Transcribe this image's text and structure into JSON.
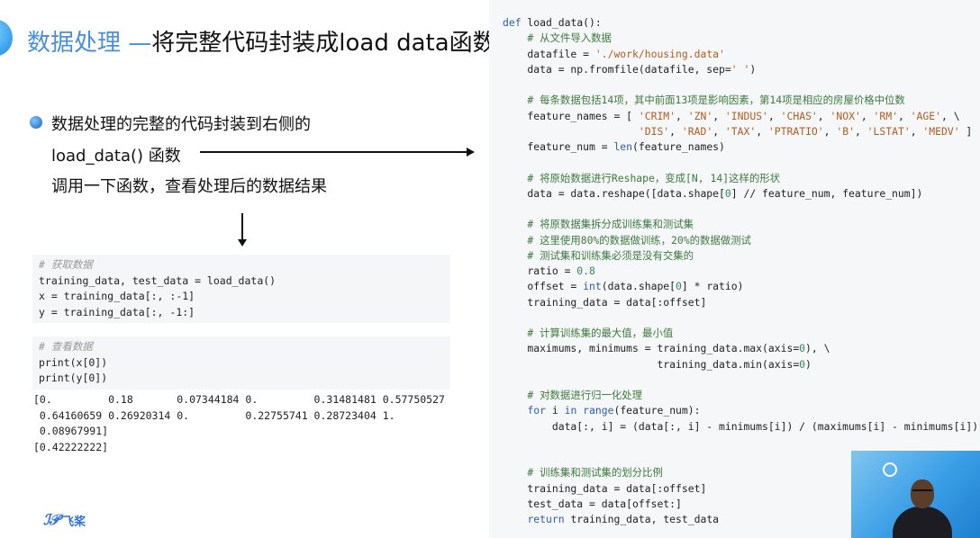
{
  "slide": {
    "title_part1": "数据处理 ",
    "title_dash": "—",
    "title_part2": "将完整代码封装成load data函数",
    "bullet_line1": "数据处理的完整的代码封装到右侧的",
    "bullet_line2": "load_data() 函数",
    "bullet_line3": "调用一下函数，查看处理后的数据结果",
    "logo_text": "飞桨",
    "logo_mark": "ℐ𝒫"
  },
  "notebook": {
    "cell1": {
      "comment": "# 获取数据",
      "lines": [
        "training_data, test_data = load_data()",
        "x = training_data[:, :-1]",
        "y = training_data[:, -1:]"
      ]
    },
    "cell2": {
      "comment": "# 查看数据",
      "lines": [
        "print(x[0])",
        "print(y[0])"
      ]
    },
    "output": [
      "[0.         0.18       0.07344184 0.         0.31481481 0.57750527",
      " 0.64160659 0.26920314 0.         0.22755741 0.28723404 1.",
      " 0.08967991]",
      "[0.42222222]"
    ]
  },
  "code": {
    "lines": [
      "def load_data():",
      "    # 从文件导入数据",
      "    datafile = './work/housing.data'",
      "    data = np.fromfile(datafile, sep=' ')",
      "",
      "    # 每条数据包括14项，其中前面13项是影响因素，第14项是相应的房屋价格中位数",
      "    feature_names = [ 'CRIM', 'ZN', 'INDUS', 'CHAS', 'NOX', 'RM', 'AGE', \\",
      "                      'DIS', 'RAD', 'TAX', 'PTRATIO', 'B', 'LSTAT', 'MEDV' ]",
      "    feature_num = len(feature_names)",
      "",
      "    # 将原始数据进行Reshape，变成[N, 14]这样的形状",
      "    data = data.reshape([data.shape[0] // feature_num, feature_num])",
      "",
      "    # 将原数据集拆分成训练集和测试集",
      "    # 这里使用80%的数据做训练，20%的数据做测试",
      "    # 测试集和训练集必须是没有交集的",
      "    ratio = 0.8",
      "    offset = int(data.shape[0] * ratio)",
      "    training_data = data[:offset]",
      "",
      "    # 计算训练集的最大值，最小值",
      "    maximums, minimums = training_data.max(axis=0), \\",
      "                         training_data.min(axis=0)",
      "",
      "    # 对数据进行归一化处理",
      "    for i in range(feature_num):",
      "        data[:, i] = (data[:, i] - minimums[i]) / (maximums[i] - minimums[i])",
      "",
      "",
      "    # 训练集和测试集的划分比例",
      "    training_data = data[:offset]",
      "    test_data = data[offset:]",
      "    return training_data, test_data"
    ]
  },
  "colors": {
    "accent_blue": "#4a90d9",
    "code_bg": "#f6f7f9",
    "cell_bg": "#f5f6f8",
    "logo_blue": "#2f6fe4"
  }
}
